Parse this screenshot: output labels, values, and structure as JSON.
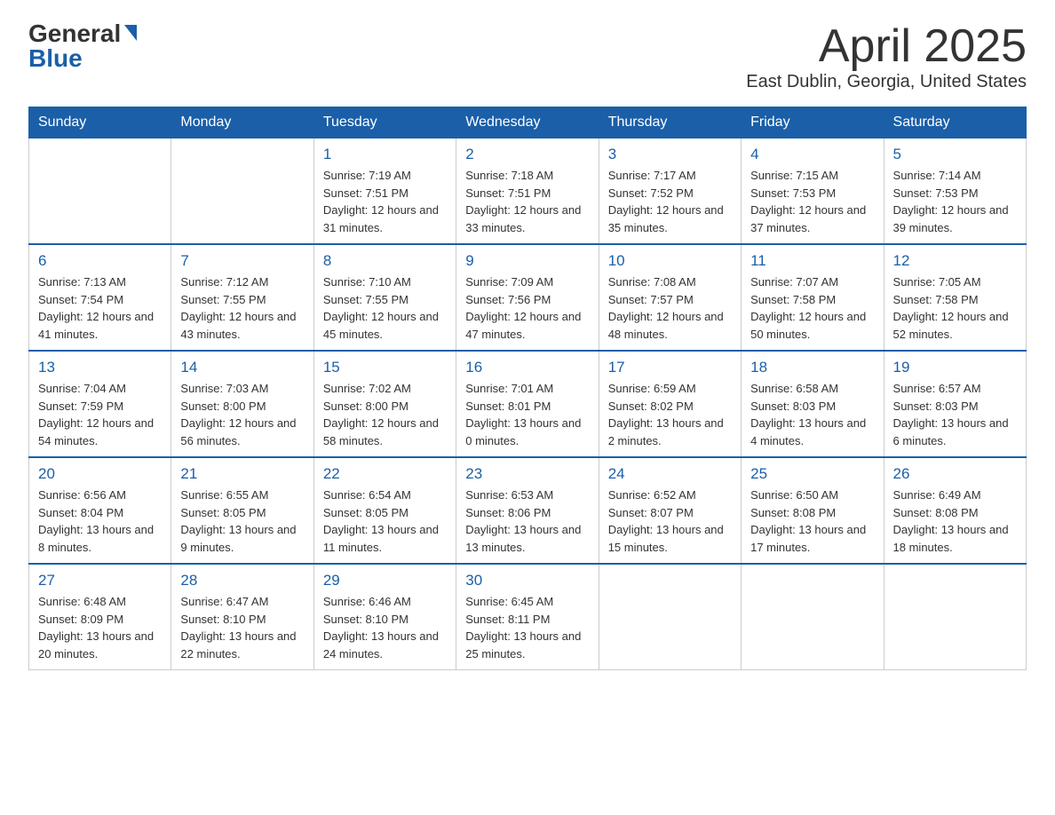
{
  "header": {
    "logo_general": "General",
    "logo_blue": "Blue",
    "title": "April 2025",
    "subtitle": "East Dublin, Georgia, United States"
  },
  "days_of_week": [
    "Sunday",
    "Monday",
    "Tuesday",
    "Wednesday",
    "Thursday",
    "Friday",
    "Saturday"
  ],
  "weeks": [
    [
      {
        "day": "",
        "sunrise": "",
        "sunset": "",
        "daylight": ""
      },
      {
        "day": "",
        "sunrise": "",
        "sunset": "",
        "daylight": ""
      },
      {
        "day": "1",
        "sunrise": "Sunrise: 7:19 AM",
        "sunset": "Sunset: 7:51 PM",
        "daylight": "Daylight: 12 hours and 31 minutes."
      },
      {
        "day": "2",
        "sunrise": "Sunrise: 7:18 AM",
        "sunset": "Sunset: 7:51 PM",
        "daylight": "Daylight: 12 hours and 33 minutes."
      },
      {
        "day": "3",
        "sunrise": "Sunrise: 7:17 AM",
        "sunset": "Sunset: 7:52 PM",
        "daylight": "Daylight: 12 hours and 35 minutes."
      },
      {
        "day": "4",
        "sunrise": "Sunrise: 7:15 AM",
        "sunset": "Sunset: 7:53 PM",
        "daylight": "Daylight: 12 hours and 37 minutes."
      },
      {
        "day": "5",
        "sunrise": "Sunrise: 7:14 AM",
        "sunset": "Sunset: 7:53 PM",
        "daylight": "Daylight: 12 hours and 39 minutes."
      }
    ],
    [
      {
        "day": "6",
        "sunrise": "Sunrise: 7:13 AM",
        "sunset": "Sunset: 7:54 PM",
        "daylight": "Daylight: 12 hours and 41 minutes."
      },
      {
        "day": "7",
        "sunrise": "Sunrise: 7:12 AM",
        "sunset": "Sunset: 7:55 PM",
        "daylight": "Daylight: 12 hours and 43 minutes."
      },
      {
        "day": "8",
        "sunrise": "Sunrise: 7:10 AM",
        "sunset": "Sunset: 7:55 PM",
        "daylight": "Daylight: 12 hours and 45 minutes."
      },
      {
        "day": "9",
        "sunrise": "Sunrise: 7:09 AM",
        "sunset": "Sunset: 7:56 PM",
        "daylight": "Daylight: 12 hours and 47 minutes."
      },
      {
        "day": "10",
        "sunrise": "Sunrise: 7:08 AM",
        "sunset": "Sunset: 7:57 PM",
        "daylight": "Daylight: 12 hours and 48 minutes."
      },
      {
        "day": "11",
        "sunrise": "Sunrise: 7:07 AM",
        "sunset": "Sunset: 7:58 PM",
        "daylight": "Daylight: 12 hours and 50 minutes."
      },
      {
        "day": "12",
        "sunrise": "Sunrise: 7:05 AM",
        "sunset": "Sunset: 7:58 PM",
        "daylight": "Daylight: 12 hours and 52 minutes."
      }
    ],
    [
      {
        "day": "13",
        "sunrise": "Sunrise: 7:04 AM",
        "sunset": "Sunset: 7:59 PM",
        "daylight": "Daylight: 12 hours and 54 minutes."
      },
      {
        "day": "14",
        "sunrise": "Sunrise: 7:03 AM",
        "sunset": "Sunset: 8:00 PM",
        "daylight": "Daylight: 12 hours and 56 minutes."
      },
      {
        "day": "15",
        "sunrise": "Sunrise: 7:02 AM",
        "sunset": "Sunset: 8:00 PM",
        "daylight": "Daylight: 12 hours and 58 minutes."
      },
      {
        "day": "16",
        "sunrise": "Sunrise: 7:01 AM",
        "sunset": "Sunset: 8:01 PM",
        "daylight": "Daylight: 13 hours and 0 minutes."
      },
      {
        "day": "17",
        "sunrise": "Sunrise: 6:59 AM",
        "sunset": "Sunset: 8:02 PM",
        "daylight": "Daylight: 13 hours and 2 minutes."
      },
      {
        "day": "18",
        "sunrise": "Sunrise: 6:58 AM",
        "sunset": "Sunset: 8:03 PM",
        "daylight": "Daylight: 13 hours and 4 minutes."
      },
      {
        "day": "19",
        "sunrise": "Sunrise: 6:57 AM",
        "sunset": "Sunset: 8:03 PM",
        "daylight": "Daylight: 13 hours and 6 minutes."
      }
    ],
    [
      {
        "day": "20",
        "sunrise": "Sunrise: 6:56 AM",
        "sunset": "Sunset: 8:04 PM",
        "daylight": "Daylight: 13 hours and 8 minutes."
      },
      {
        "day": "21",
        "sunrise": "Sunrise: 6:55 AM",
        "sunset": "Sunset: 8:05 PM",
        "daylight": "Daylight: 13 hours and 9 minutes."
      },
      {
        "day": "22",
        "sunrise": "Sunrise: 6:54 AM",
        "sunset": "Sunset: 8:05 PM",
        "daylight": "Daylight: 13 hours and 11 minutes."
      },
      {
        "day": "23",
        "sunrise": "Sunrise: 6:53 AM",
        "sunset": "Sunset: 8:06 PM",
        "daylight": "Daylight: 13 hours and 13 minutes."
      },
      {
        "day": "24",
        "sunrise": "Sunrise: 6:52 AM",
        "sunset": "Sunset: 8:07 PM",
        "daylight": "Daylight: 13 hours and 15 minutes."
      },
      {
        "day": "25",
        "sunrise": "Sunrise: 6:50 AM",
        "sunset": "Sunset: 8:08 PM",
        "daylight": "Daylight: 13 hours and 17 minutes."
      },
      {
        "day": "26",
        "sunrise": "Sunrise: 6:49 AM",
        "sunset": "Sunset: 8:08 PM",
        "daylight": "Daylight: 13 hours and 18 minutes."
      }
    ],
    [
      {
        "day": "27",
        "sunrise": "Sunrise: 6:48 AM",
        "sunset": "Sunset: 8:09 PM",
        "daylight": "Daylight: 13 hours and 20 minutes."
      },
      {
        "day": "28",
        "sunrise": "Sunrise: 6:47 AM",
        "sunset": "Sunset: 8:10 PM",
        "daylight": "Daylight: 13 hours and 22 minutes."
      },
      {
        "day": "29",
        "sunrise": "Sunrise: 6:46 AM",
        "sunset": "Sunset: 8:10 PM",
        "daylight": "Daylight: 13 hours and 24 minutes."
      },
      {
        "day": "30",
        "sunrise": "Sunrise: 6:45 AM",
        "sunset": "Sunset: 8:11 PM",
        "daylight": "Daylight: 13 hours and 25 minutes."
      },
      {
        "day": "",
        "sunrise": "",
        "sunset": "",
        "daylight": ""
      },
      {
        "day": "",
        "sunrise": "",
        "sunset": "",
        "daylight": ""
      },
      {
        "day": "",
        "sunrise": "",
        "sunset": "",
        "daylight": ""
      }
    ]
  ]
}
